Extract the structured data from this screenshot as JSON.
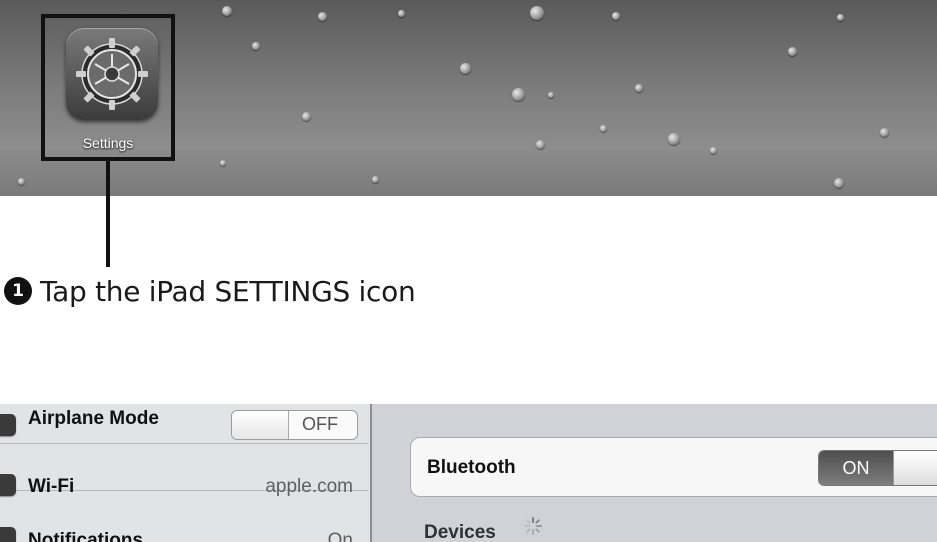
{
  "home_screen": {
    "app_label": "Settings",
    "icon": "settings-gear-icon"
  },
  "instruction": {
    "step_number": "1",
    "text": "Tap the iPad SETTINGS icon"
  },
  "settings_sidebar": {
    "items": [
      {
        "label": "Airplane Mode",
        "value": "OFF",
        "icon": "airplane-icon"
      },
      {
        "label": "Wi-Fi",
        "value": "apple.com",
        "icon": "wifi-icon"
      },
      {
        "label": "Notifications",
        "value": "On",
        "icon": "notifications-icon"
      }
    ]
  },
  "bluetooth_panel": {
    "label": "Bluetooth",
    "toggle_value": "ON",
    "devices_label": "Devices"
  },
  "colors": {
    "wallpaper": "#7c7c7c",
    "sidebar_bg": "#e2e3e5",
    "pane_bg": "#cfd2d7",
    "callout_black": "#111111"
  }
}
